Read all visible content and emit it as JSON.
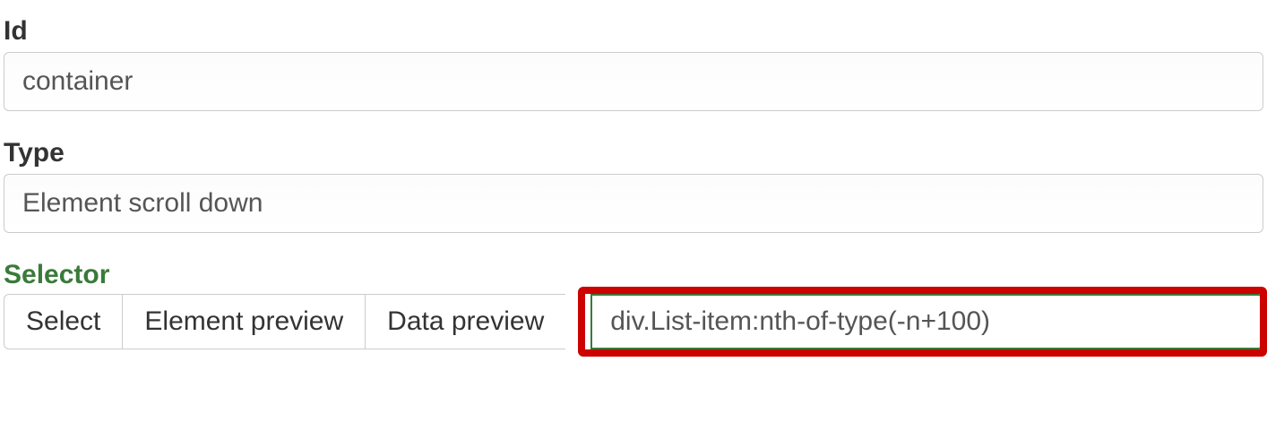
{
  "fields": {
    "id": {
      "label": "Id",
      "value": "container"
    },
    "type": {
      "label": "Type",
      "value": "Element scroll down"
    },
    "selector": {
      "label": "Selector",
      "buttons": {
        "select": "Select",
        "element_preview": "Element preview",
        "data_preview": "Data preview"
      },
      "value": "div.List-item:nth-of-type(-n+100)"
    }
  }
}
